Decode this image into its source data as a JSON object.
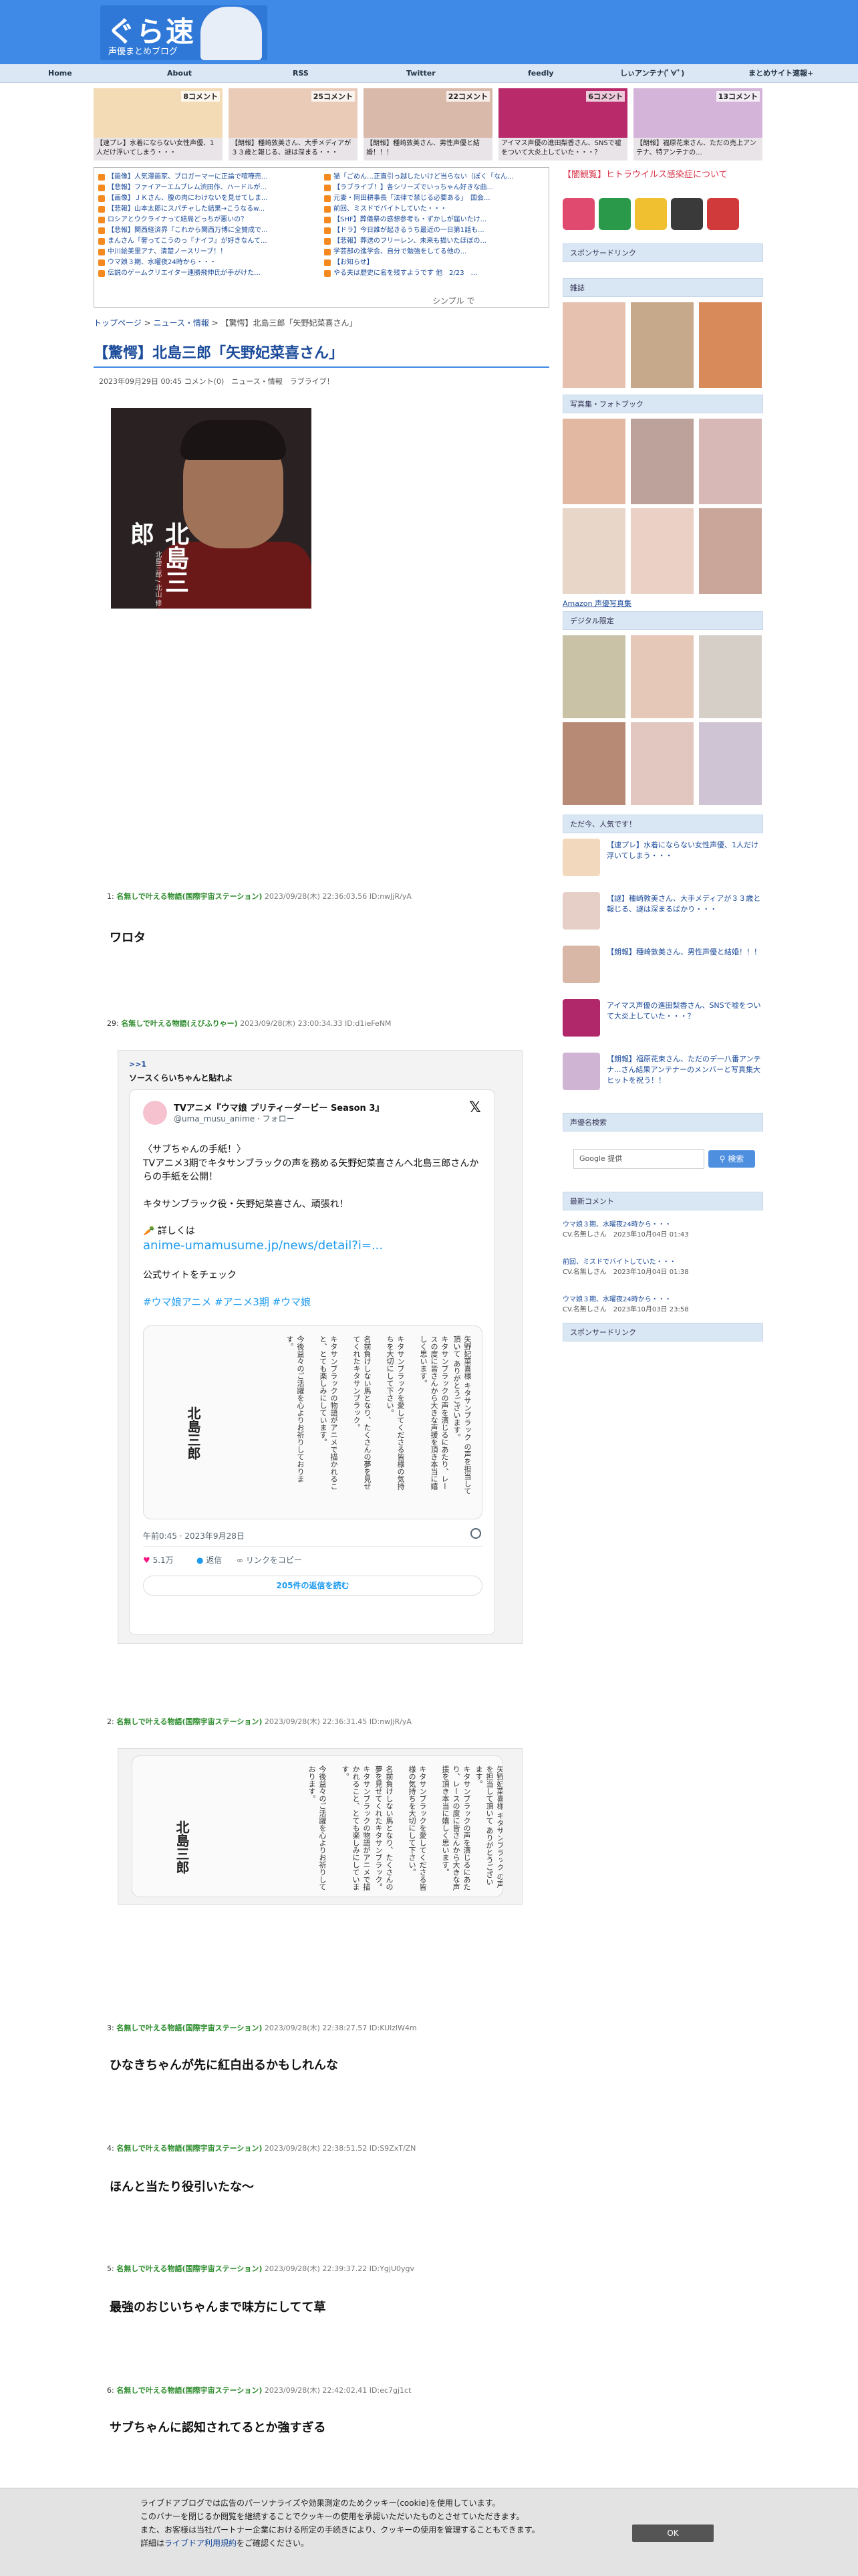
{
  "site": {
    "logo_text": "ぐら速",
    "logo_sub": "声優まとめブログ"
  },
  "nav": [
    "Home",
    "About",
    "RSS",
    "Twitter",
    "feedly",
    "しぃアンテナ(ﾟ∀ﾟ)",
    "まとめサイト速報+"
  ],
  "thumbs": [
    {
      "comments": "8コメント",
      "title": "【速プレ】水着にならない女性声優、1人だけ浮いてしまう・・・"
    },
    {
      "comments": "25コメント",
      "title": "【朗報】種崎敦美さん、大手メディアが３３歳と報じる、謎は深まる・・・"
    },
    {
      "comments": "22コメント",
      "title": "【朗報】種崎敦美さん、男性声優と結婚！！！"
    },
    {
      "comments": "6コメント",
      "title": "アイマス声優の進田梨香さん、SNSで嘘をついて大炎上していた・・・？"
    },
    {
      "comments": "13コメント",
      "title": "【朗報】福原花束さん、ただの売上アンテナ、特アンテナの..."
    }
  ],
  "rss_left": [
    "【画像】人気漫画家、ブロガーマーに正論で喧嘩売...",
    "【悲報】ファイアーエムブレム渋田作、ハードルが...",
    "【画像】ＪＫさん、腹の肉にわけないを見せてしま...",
    "【悲報】山本太郎にスパチャした結果→こうなるw...",
    "ロシアとウクライナって結局どっちが悪いの？",
    "【悲報】関西経済界『これから関西万博に全賛成で...",
    "まんさん「奢ってこうのっ『ナイフ』が好きなんて...",
    "中川絵美里アナ、清楚ノースリーブ！！",
    "ウマ娘３期、水曜夜24時から・・・",
    "伝説のゲームクリエイター連勝飛伸氏が手がけた..."
  ],
  "rss_right": [
    "猫「ごめん…正直引っ越したいけど当らない（ぽく「なん...",
    "【ラブライブ！】各シリーズでいっちゃん好きな曲...",
    "元妻・岡田耕事長「法律で禁じる必要ある」　国会...",
    "前回、ミスドでバイトしていた・・・",
    "【SHF】葬儀祭の感想参考も・ずかしが届いたけ...",
    "【ドラ】今日誰が起きるうち最近の一日第1話も...",
    "【悲報】葬送のフリーレン、未来も描いたほぼの...",
    "学芸部の進学会、自分で勉強をしてる他の...",
    "【お知らせ】",
    "やる夫は歴史に名を残すようです 他　2/23　..."
  ],
  "rss_simple": "シンプル で",
  "breadcrumb": {
    "home": "トップページ",
    "sep1": " > ",
    "cat": "ニュース・情報",
    "sep2": " > ",
    "current": "【驚愕】北島三郎「矢野妃菜喜さん」"
  },
  "article": {
    "title": "【驚愕】北島三郎「矢野妃菜喜さん」",
    "meta": "2023年09月29日 00:45 コメント(0)　ニュース・情報　ラブライブ！",
    "photo_name": "北島三郎",
    "photo_sub": "北島三郎 / 北山 修"
  },
  "replies": [
    {
      "num": "1:",
      "name": "名無しで叶える物語(国際宇宙ステーション)",
      "date": "2023/09/28(木) 22:36:03.56 ID:nwJjR/yA",
      "body": "ワロタ"
    },
    {
      "num": "29:",
      "name": "名無しで叶える物語(えびふりゃー)",
      "date": "2023/09/28(木) 23:00:34.33 ID:d1ieFeNM",
      "body": ""
    },
    {
      "num": "2:",
      "name": "名無しで叶える物語(国際宇宙ステーション)",
      "date": "2023/09/28(木) 22:36:31.45 ID:nwJjR/yA",
      "body": ""
    },
    {
      "num": "3:",
      "name": "名無しで叶える物語(国際宇宙ステーション)",
      "date": "2023/09/28(木) 22:38:27.57 ID:KUlzlW4m",
      "body": "ひなきちゃんが先に紅白出るかもしれんな"
    },
    {
      "num": "4:",
      "name": "名無しで叶える物語(国際宇宙ステーション)",
      "date": "2023/09/28(木) 22:38:51.52 ID:S9ZxT/ZN",
      "body": "ほんと当たり役引いたな〜"
    },
    {
      "num": "5:",
      "name": "名無しで叶える物語(国際宇宙ステーション)",
      "date": "2023/09/28(木) 22:39:37.22 ID:YgjU0ygv",
      "body": "最強のおじいちゃんまで味方にしてて草"
    },
    {
      "num": "6:",
      "name": "名無しで叶える物語(国際宇宙ステーション)",
      "date": "2023/09/28(木) 22:42:02.41 ID:ec7gj1ct",
      "body": "サブちゃんに認知されてるとか強すぎる"
    }
  ],
  "embed": {
    "quote": ">>1",
    "quote_text": "ソースくらいちゃんと貼れよ",
    "tweet_name": "TVアニメ『ウマ娘 プリティーダービー Season 3』",
    "tweet_handle": "@uma_musu_anime · フォロー",
    "line1": "〈サブちゃんの手紙！〉",
    "line2": "TVアニメ3期でキタサンブラックの声を務める矢野妃菜喜さんへ北島三郎さんからの手紙を公開！",
    "line3": "キタサンブラック役・矢野妃菜喜さん、頑張れ！",
    "line4": "🥕 詳しくは",
    "link": "anime-umamusume.jp/news/detail?i=...",
    "line5": "公式サイトをチェック",
    "tags": "#ウマ娘アニメ #アニメ3期 #ウマ娘",
    "letter_col1": "矢野妃菜喜様 キタサンブラック の声を担当して頂いて ありがとうございます。",
    "letter_col2": "キタサンブラックの声を演じるにあたり、レースの度に皆さんから大きな声援を頂き本当に嬉しく思います。",
    "letter_col3": "キタサンブラックを愛してくださる皆様の気持ちを大切にして下さい。",
    "letter_col4": "名前負けしない馬となり、たくさんの夢を見せてくれたキタサンブラック。",
    "letter_col5": "キタサンブラックの物語がアニメで描かれること、とても楽しみにしています。",
    "letter_col6": "今後益々のご活躍を心よりお祈りしております。",
    "signature": "北島三郎",
    "time": "午前0:45 · 2023年9月28日",
    "likes": "5.1万",
    "reply": "返信",
    "copy": "リンクをコピー",
    "button": "205件の返信を読む"
  },
  "sidebar": {
    "notice": "【闇観覧】ヒトラウイルス感染症について",
    "sponsored1": "スポンサードリンク",
    "magazine": "雑誌",
    "photobook": "写真集・フォトブック",
    "amazon": "Amazon 声優写真集",
    "digital": "デジタル限定",
    "popular": "ただ今、人気です！",
    "popular_items": [
      "【速プレ】水着にならない女性声優、1人だけ浮いてしまう・・・",
      "【謎】種崎敦美さん、大手メディアが３３歳と報じる、謎は深まるばかり・・・",
      "【朗報】種崎敦美さん、男性声優と結婚！！！",
      "アイマス声優の進田梨香さん、SNSで嘘をついて大炎上していた・・・？",
      "【朗報】福原花束さん、ただのデ一八番アンテナ...さん結果アンテナーのメンバーと写真集大ヒットを祝う！！"
    ],
    "search_head": "声優名検索",
    "search_placeholder": "Google 提供",
    "search_btn": "検索",
    "recent_head": "最新コメント",
    "recent": [
      {
        "t": "ウマ娘３期、水曜夜24時から・・・",
        "s": "CV.名無しさん　2023年10月04日 01:43"
      },
      {
        "t": "前回、ミスドでバイトしていた・・・",
        "s": "CV.名無しさん　2023年10月04日 01:38"
      },
      {
        "t": "ウマ娘３期、水曜夜24時から・・・",
        "s": "CV.名無しさん　2023年10月03日 23:58"
      }
    ],
    "sponsored2": "スポンサードリンク"
  },
  "cookie": {
    "line1": "ライブドアブログでは広告のパーソナライズや効果測定のためクッキー(cookie)を使用しています。",
    "line2": "このバナーを閉じるか閲覧を継続することでクッキーの使用を承認いただいたものとさせていただきます。",
    "line3": "また、お客様は当社パートナー企業における所定の手続きにより、クッキーの使用を管理することもできます。",
    "line4_pre": "詳細は",
    "line4_link": "ライブドア利用規約",
    "line4_post": "をご確認ください。",
    "button": "OK"
  },
  "colors": {
    "header": "#3f8ae6",
    "nav": "#dbe7f5",
    "link": "#1a4a9a",
    "name": "#2a8a2a",
    "notice": "#d8344a"
  }
}
